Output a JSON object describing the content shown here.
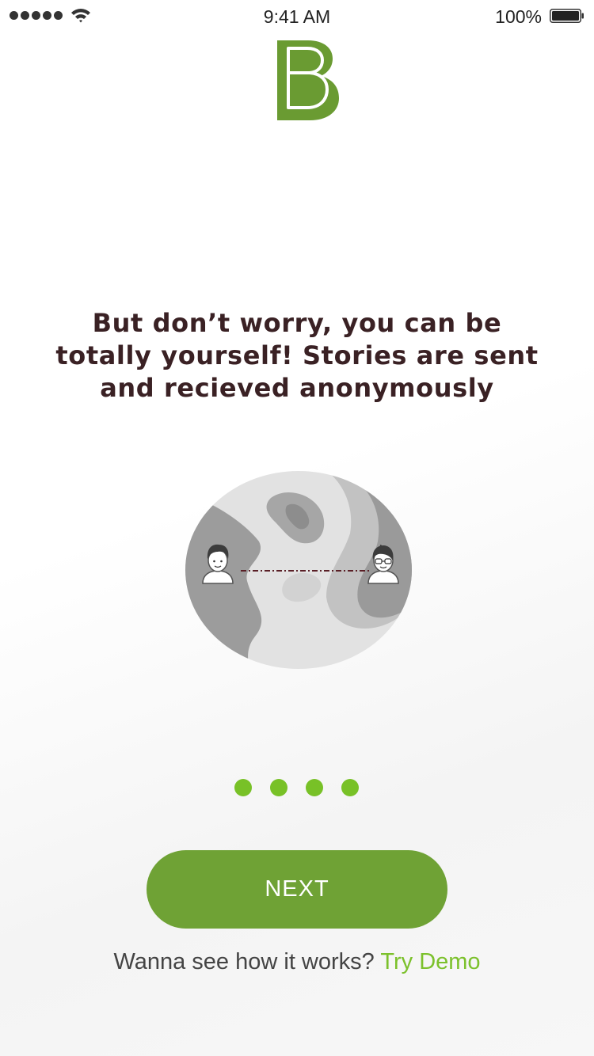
{
  "status_bar": {
    "time": "9:41 AM",
    "battery_percent": "100%",
    "signal_icon": "signal-dots-icon",
    "wifi_icon": "wifi-icon",
    "battery_icon": "battery-full-icon",
    "battery_level": 1.0
  },
  "brand": {
    "logo_letter": "B",
    "color": "#6a9b32"
  },
  "onboarding": {
    "headline": "But don’t worry, you can be totally yourself! Stories are sent and recieved anonymously",
    "illustration": "globe-with-two-anonymous-users",
    "page_count": 4,
    "dot_color": "#78c127"
  },
  "actions": {
    "next_label": "NEXT",
    "demo_prompt": "Wanna see how it works?",
    "demo_link": "Try Demo",
    "button_color": "#6fa235",
    "link_color": "#7cc12c"
  }
}
